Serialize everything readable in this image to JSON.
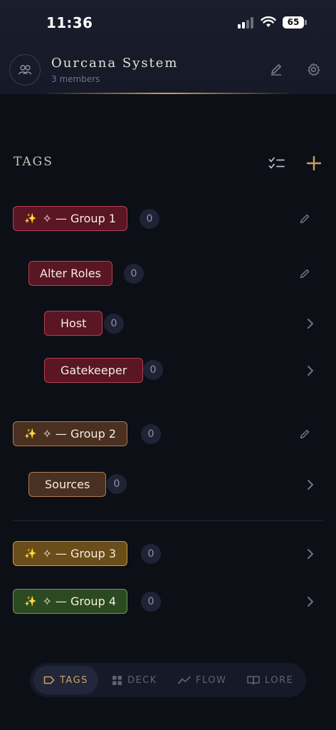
{
  "status_bar": {
    "time": "11:36",
    "battery": "65"
  },
  "header": {
    "title": "Ourcana System",
    "subtitle": "3 members"
  },
  "section": {
    "title": "TAGS"
  },
  "tags": [
    {
      "label": "✧ — Group 1",
      "count": "0",
      "sparkle": "✨",
      "color": "#5a1624"
    },
    {
      "label": "Alter Roles",
      "count": "0",
      "color": "#5a1624"
    },
    {
      "label": "Host",
      "count": "0",
      "color": "#5a1624"
    },
    {
      "label": "Gatekeeper",
      "count": "0",
      "color": "#5a1624"
    },
    {
      "label": "✧ — Group 2",
      "count": "0",
      "sparkle": "✨",
      "color": "#4a3020"
    },
    {
      "label": "Sources",
      "count": "0",
      "color": "#4a3020"
    },
    {
      "label": "✧ — Group 3",
      "count": "0",
      "sparkle": "✨",
      "color": "#6a4d19"
    },
    {
      "label": "✧ — Group 4",
      "count": "0",
      "sparkle": "✨",
      "color": "#2c4a22"
    }
  ],
  "nav": [
    {
      "label": "TAGS",
      "icon": "tag-icon",
      "active": true
    },
    {
      "label": "DECK",
      "icon": "grid-icon",
      "active": false
    },
    {
      "label": "FLOW",
      "icon": "trend-icon",
      "active": false
    },
    {
      "label": "LORE",
      "icon": "book-icon",
      "active": false
    }
  ],
  "colors": {
    "accent": "#c9a35c",
    "background": "#0d0f16"
  }
}
